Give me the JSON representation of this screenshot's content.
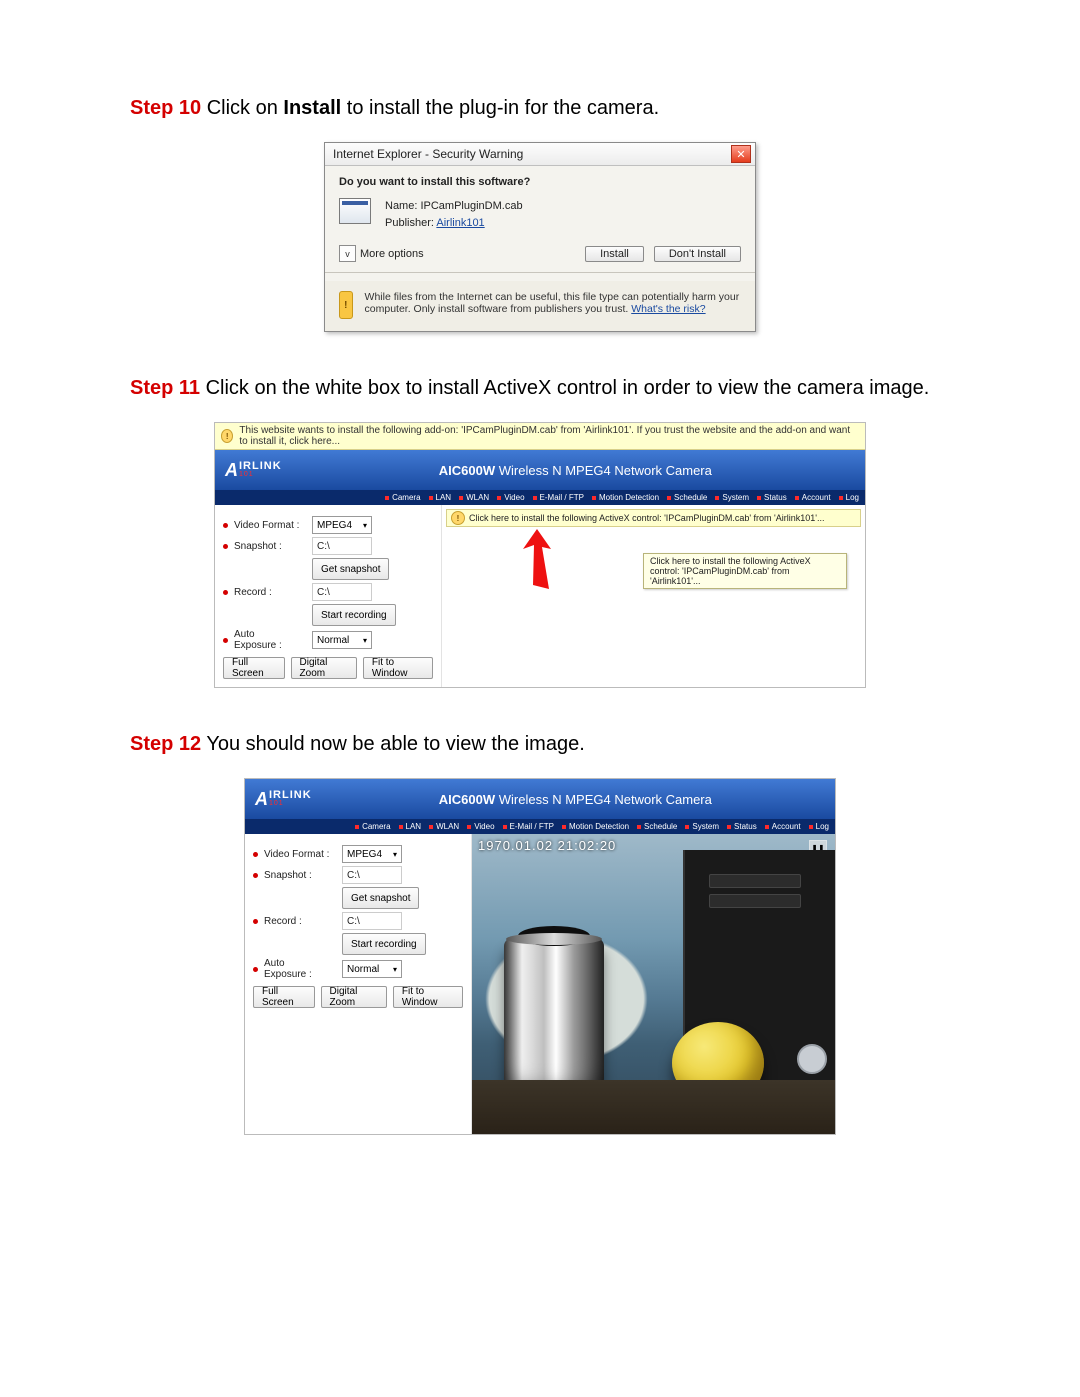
{
  "steps": {
    "s10": {
      "label": "Step 10",
      "text_a": " Click on ",
      "bold": "Install",
      "text_b": " to install the plug-in for the camera."
    },
    "s11": {
      "label": "Step 11",
      "text": " Click on the white box to install ActiveX control in order to view the camera image."
    },
    "s12": {
      "label": "Step 12",
      "text": " You should now be able to view the image."
    }
  },
  "dialog": {
    "title": "Internet Explorer - Security Warning",
    "close": "✕",
    "question": "Do you want to install this software?",
    "name_label": "Name:",
    "name_value": "IPCamPluginDM.cab",
    "publisher_label": "Publisher:",
    "publisher_value": "Airlink101",
    "more_arrow": "v",
    "more_label": "More options",
    "install": "Install",
    "dont_install": "Don't Install",
    "shield": "!",
    "warn_text": "While files from the Internet can be useful, this file type can potentially harm your computer. Only install software from publishers you trust. ",
    "risk_link": "What's the risk?"
  },
  "camera": {
    "yellowbar": "This website wants to install the following add-on: 'IPCamPluginDM.cab' from 'Airlink101'. If you trust the website and the add-on and want to install it, click here...",
    "mini_yellow": "Click here to install the following ActiveX control: 'IPCamPluginDM.cab' from 'Airlink101'...",
    "tooltip": "Click here to install the following ActiveX control: 'IPCamPluginDM.cab' from 'Airlink101'...",
    "logo_A": "A",
    "logo_text": "IRLINK",
    "logo_sub": "101",
    "title_model": "AIC600W",
    "title_rest": " Wireless N MPEG4 Network Camera",
    "nav": [
      "Camera",
      "LAN",
      "WLAN",
      "Video",
      "E-Mail / FTP",
      "Motion Detection",
      "Schedule",
      "System",
      "Status",
      "Account",
      "Log"
    ],
    "side": {
      "vfmt_label": "Video Format :",
      "vfmt_value": "MPEG4",
      "snap_label": "Snapshot :",
      "snap_value": "C:\\",
      "snap_btn": "Get snapshot",
      "rec_label": "Record :",
      "rec_value": "C:\\",
      "rec_btn": "Start recording",
      "ae_label1": "Auto",
      "ae_label2": "Exposure :",
      "ae_value": "Normal",
      "b1": "Full Screen",
      "b2": "Digital Zoom",
      "b3": "Fit to Window"
    },
    "scene": {
      "timestamp": "1970.01.02 21:02:20",
      "ctrl": {
        "pause": "❚❚",
        "stop": "■",
        "target": "◎"
      }
    }
  }
}
